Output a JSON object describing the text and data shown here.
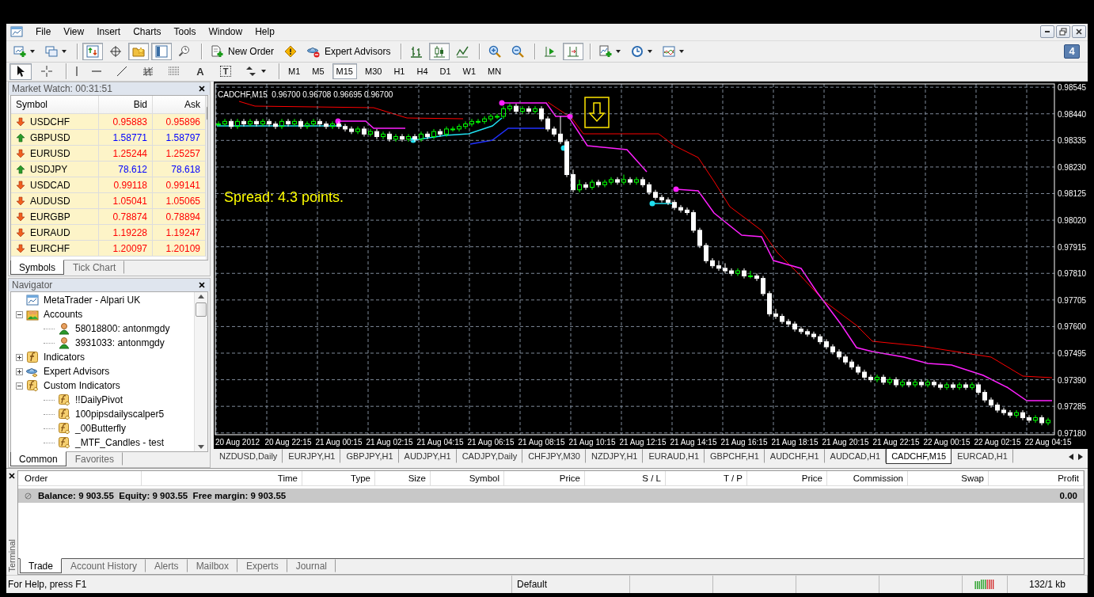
{
  "menu": {
    "items": [
      "File",
      "View",
      "Insert",
      "Charts",
      "Tools",
      "Window",
      "Help"
    ]
  },
  "toolbar": [
    [
      {
        "kind": "new-chart",
        "dropdown": true,
        "selected": false
      },
      {
        "kind": "profiles",
        "dropdown": true,
        "selected": false
      }
    ],
    [
      {
        "kind": "market-watch",
        "selected": true
      },
      {
        "kind": "data-window",
        "selected": false
      },
      {
        "kind": "favorites",
        "selected": true
      },
      {
        "kind": "navigator",
        "selected": true
      },
      {
        "kind": "tester",
        "selected": false
      }
    ],
    [
      {
        "kind": "new-order",
        "label": "New Order",
        "selected": false
      },
      {
        "kind": "alert",
        "selected": false
      },
      {
        "kind": "experts",
        "label": "Expert Advisors",
        "selected": false
      }
    ],
    [
      {
        "kind": "bar-chart",
        "selected": false
      },
      {
        "kind": "candle-chart",
        "selected": true
      },
      {
        "kind": "line-chart",
        "selected": false
      }
    ],
    [
      {
        "kind": "zoom-in",
        "selected": false
      },
      {
        "kind": "zoom-out",
        "selected": false
      }
    ],
    [
      {
        "kind": "autoscroll",
        "selected": false
      },
      {
        "kind": "chart-shift",
        "selected": true
      }
    ],
    [
      {
        "kind": "indicators",
        "dropdown": true,
        "selected": false
      },
      {
        "kind": "periods",
        "dropdown": true,
        "selected": false
      },
      {
        "kind": "templates",
        "dropdown": true,
        "selected": false
      }
    ]
  ],
  "badge": "4",
  "tools": [
    [
      {
        "kind": "cursor",
        "selected": true
      },
      {
        "kind": "crosshair",
        "selected": false
      }
    ],
    [
      {
        "kind": "vline",
        "selected": false
      },
      {
        "kind": "hline",
        "selected": false
      },
      {
        "kind": "trendline",
        "selected": false
      },
      {
        "kind": "fibo",
        "selected": false
      },
      {
        "kind": "fibo-channel",
        "selected": false
      },
      {
        "kind": "text",
        "glyph": "A",
        "selected": false
      },
      {
        "kind": "label",
        "glyph": "T",
        "selected": false
      },
      {
        "kind": "arrows",
        "dropdown": true,
        "selected": false
      }
    ]
  ],
  "timeframes": [
    {
      "label": "M1",
      "selected": false
    },
    {
      "label": "M5",
      "selected": false
    },
    {
      "label": "M15",
      "selected": true
    },
    {
      "label": "M30",
      "selected": false
    },
    {
      "label": "H1",
      "selected": false
    },
    {
      "label": "H4",
      "selected": false
    },
    {
      "label": "D1",
      "selected": false
    },
    {
      "label": "W1",
      "selected": false
    },
    {
      "label": "MN",
      "selected": false
    }
  ],
  "market_watch": {
    "title": "Market Watch: 00:31:51",
    "columns": [
      "Symbol",
      "Bid",
      "Ask"
    ],
    "rows": [
      {
        "symbol": "USDCHF",
        "bid": "0.95883",
        "ask": "0.95896",
        "kind": "down"
      },
      {
        "symbol": "GBPUSD",
        "bid": "1.58771",
        "ask": "1.58797",
        "kind": "up"
      },
      {
        "symbol": "EURUSD",
        "bid": "1.25244",
        "ask": "1.25257",
        "kind": "down"
      },
      {
        "symbol": "USDJPY",
        "bid": "78.612",
        "ask": "78.618",
        "kind": "up"
      },
      {
        "symbol": "USDCAD",
        "bid": "0.99118",
        "ask": "0.99141",
        "kind": "down"
      },
      {
        "symbol": "AUDUSD",
        "bid": "1.05041",
        "ask": "1.05065",
        "kind": "down"
      },
      {
        "symbol": "EURGBP",
        "bid": "0.78874",
        "ask": "0.78894",
        "kind": "down"
      },
      {
        "symbol": "EURAUD",
        "bid": "1.19228",
        "ask": "1.19247",
        "kind": "down"
      },
      {
        "symbol": "EURCHF",
        "bid": "1.20097",
        "ask": "1.20109",
        "kind": "down"
      }
    ],
    "tabs": [
      {
        "label": "Symbols",
        "selected": true
      },
      {
        "label": "Tick Chart",
        "selected": false
      }
    ]
  },
  "navigator": {
    "title": "Navigator",
    "tree": [
      {
        "label": "MetaTrader - Alpari UK",
        "kind": "terminal"
      },
      {
        "label": "Accounts",
        "kind": "accounts",
        "expanded": true,
        "children": [
          {
            "label": "58018800: antonmgdy",
            "kind": "account"
          },
          {
            "label": "3931033: antonmgdy",
            "kind": "account"
          }
        ]
      },
      {
        "label": "Indicators",
        "kind": "indicators",
        "expanded": false
      },
      {
        "label": "Expert Advisors",
        "kind": "experts",
        "expanded": false
      },
      {
        "label": "Custom Indicators",
        "kind": "custom",
        "expanded": true,
        "children": [
          {
            "label": "!!DailyPivot",
            "kind": "custom"
          },
          {
            "label": "100pipsdailyscalper5",
            "kind": "custom"
          },
          {
            "label": "_00Butterfly",
            "kind": "custom"
          },
          {
            "label": "_MTF_Candles - test",
            "kind": "custom"
          }
        ]
      }
    ],
    "tabs": [
      {
        "label": "Common",
        "selected": true
      },
      {
        "label": "Favorites",
        "selected": false
      }
    ]
  },
  "chart": {
    "title": "CADCHF,M15",
    "ohlc": "0.96700 0.96708 0.96695 0.96700",
    "spread": "Spread: 4.3 points.",
    "chart_data": {
      "type": "candlestick",
      "categories": [
        null,
        null,
        null,
        "20 Aug 2012",
        null,
        null,
        null,
        null,
        null,
        null,
        null,
        "20 Aug 22:15",
        null,
        null,
        null,
        null,
        null,
        null,
        null,
        "21 Aug 00:15",
        null,
        null,
        null,
        null,
        null,
        null,
        null,
        "21 Aug 02:15",
        null,
        null,
        null,
        null,
        null,
        null,
        null,
        "21 Aug 04:15",
        null,
        null,
        null,
        null,
        null,
        null,
        null,
        "21 Aug 06:15",
        null,
        null,
        null,
        null,
        null,
        null,
        null,
        "21 Aug 08:15",
        null,
        null,
        null,
        null,
        null,
        null,
        null,
        "21 Aug 10:15",
        null,
        null,
        null,
        null,
        null,
        null,
        null,
        "21 Aug 12:15",
        null,
        null,
        null,
        null,
        null,
        null,
        null,
        "21 Aug 14:15",
        null,
        null,
        null,
        null,
        null,
        null,
        null,
        "21 Aug 16:15",
        null,
        null,
        null,
        null,
        null,
        null,
        null,
        "21 Aug 18:15",
        null,
        null,
        null,
        null,
        null,
        null,
        null,
        "21 Aug 20:15",
        null,
        null,
        null,
        null,
        null,
        null,
        null,
        "21 Aug 22:15",
        null,
        null,
        null,
        null,
        null,
        null,
        null,
        "22 Aug 00:15",
        null,
        null,
        null,
        null,
        null,
        null,
        null,
        "22 Aug 02:15",
        null,
        null,
        null,
        null,
        null,
        null,
        null,
        "22 Aug 04:15"
      ],
      "ylim": [
        0.97173,
        0.98558
      ],
      "grid": true,
      "ohlc": [
        [
          0.984,
          0.9841,
          0.9839,
          0.984
        ],
        [
          0.984,
          0.9842,
          0.9839,
          0.9841
        ],
        [
          0.9841,
          0.9842,
          0.9838,
          0.9839
        ],
        [
          0.9839,
          0.9842,
          0.9838,
          0.9841
        ],
        [
          0.9841,
          0.9842,
          0.9839,
          0.984
        ],
        [
          0.984,
          0.9842,
          0.9839,
          0.9841
        ],
        [
          0.9841,
          0.9842,
          0.9839,
          0.984
        ],
        [
          0.984,
          0.9842,
          0.9839,
          0.9841
        ],
        [
          0.9841,
          0.9842,
          0.9839,
          0.984
        ],
        [
          0.984,
          0.9841,
          0.9838,
          0.9839
        ],
        [
          0.9839,
          0.9842,
          0.9838,
          0.9841
        ],
        [
          0.9841,
          0.9842,
          0.9839,
          0.984
        ],
        [
          0.984,
          0.9842,
          0.9839,
          0.9841
        ],
        [
          0.9841,
          0.9842,
          0.9838,
          0.9839
        ],
        [
          0.9839,
          0.9841,
          0.9838,
          0.984
        ],
        [
          0.984,
          0.9842,
          0.9839,
          0.9841
        ],
        [
          0.9841,
          0.9842,
          0.9839,
          0.984
        ],
        [
          0.984,
          0.9841,
          0.9838,
          0.9839
        ],
        [
          0.9839,
          0.9841,
          0.9838,
          0.984
        ],
        [
          0.984,
          0.9841,
          0.9838,
          0.9839
        ],
        [
          0.9839,
          0.984,
          0.9837,
          0.9838
        ],
        [
          0.9838,
          0.9839,
          0.9836,
          0.9837
        ],
        [
          0.9837,
          0.9839,
          0.9836,
          0.9838
        ],
        [
          0.9838,
          0.9839,
          0.9835,
          0.9836
        ],
        [
          0.9836,
          0.9838,
          0.9835,
          0.9837
        ],
        [
          0.9837,
          0.9838,
          0.9834,
          0.9835
        ],
        [
          0.9835,
          0.9837,
          0.9834,
          0.9836
        ],
        [
          0.9836,
          0.9837,
          0.9833,
          0.9834
        ],
        [
          0.9834,
          0.9836,
          0.9833,
          0.9835
        ],
        [
          0.9835,
          0.9836,
          0.9833,
          0.9834
        ],
        [
          0.9834,
          0.9836,
          0.9833,
          0.9835
        ],
        [
          0.9835,
          0.9836,
          0.9833,
          0.9834
        ],
        [
          0.9834,
          0.9837,
          0.9833,
          0.9836
        ],
        [
          0.9836,
          0.9837,
          0.9834,
          0.9835
        ],
        [
          0.9835,
          0.9838,
          0.9834,
          0.9837
        ],
        [
          0.9837,
          0.9838,
          0.9835,
          0.9836
        ],
        [
          0.9836,
          0.9839,
          0.9835,
          0.9838
        ],
        [
          0.9838,
          0.9839,
          0.9837,
          0.9838
        ],
        [
          0.9838,
          0.984,
          0.9837,
          0.9839
        ],
        [
          0.9839,
          0.9841,
          0.9838,
          0.984
        ],
        [
          0.984,
          0.9842,
          0.9839,
          0.9841
        ],
        [
          0.9841,
          0.9842,
          0.984,
          0.9841
        ],
        [
          0.9841,
          0.9843,
          0.984,
          0.9842
        ],
        [
          0.9842,
          0.9844,
          0.9841,
          0.9843
        ],
        [
          0.9843,
          0.9844,
          0.9842,
          0.9843
        ],
        [
          0.9843,
          0.9847,
          0.9842,
          0.9846
        ],
        [
          0.9846,
          0.9848,
          0.9845,
          0.9847
        ],
        [
          0.9847,
          0.9848,
          0.9844,
          0.9845
        ],
        [
          0.9845,
          0.9847,
          0.9844,
          0.9846
        ],
        [
          0.9846,
          0.9847,
          0.9844,
          0.9845
        ],
        [
          0.9845,
          0.9847,
          0.9844,
          0.9846
        ],
        [
          0.9846,
          0.9847,
          0.9841,
          0.9842
        ],
        [
          0.9842,
          0.9843,
          0.9837,
          0.9838
        ],
        [
          0.9838,
          0.9839,
          0.9835,
          0.9836
        ],
        [
          0.9836,
          0.9843,
          0.9832,
          0.9833
        ],
        [
          0.9833,
          0.9834,
          0.9819,
          0.982
        ],
        [
          0.982,
          0.9822,
          0.9813,
          0.9814
        ],
        [
          0.9814,
          0.9818,
          0.9813,
          0.9816
        ],
        [
          0.9816,
          0.9817,
          0.9814,
          0.9815
        ],
        [
          0.9815,
          0.9818,
          0.9814,
          0.9817
        ],
        [
          0.9817,
          0.9818,
          0.9815,
          0.9816
        ],
        [
          0.9816,
          0.9818,
          0.9815,
          0.9817
        ],
        [
          0.9817,
          0.9819,
          0.9816,
          0.9818
        ],
        [
          0.9818,
          0.9819,
          0.9816,
          0.9817
        ],
        [
          0.9817,
          0.982,
          0.9816,
          0.9818
        ],
        [
          0.9818,
          0.9819,
          0.9816,
          0.9817
        ],
        [
          0.9817,
          0.9819,
          0.9816,
          0.9818
        ],
        [
          0.9818,
          0.9819,
          0.9815,
          0.9816
        ],
        [
          0.9816,
          0.9817,
          0.9812,
          0.9813
        ],
        [
          0.9813,
          0.9814,
          0.981,
          0.9811
        ],
        [
          0.9811,
          0.9812,
          0.9809,
          0.981
        ],
        [
          0.981,
          0.9811,
          0.9808,
          0.9809
        ],
        [
          0.9809,
          0.981,
          0.9806,
          0.9807
        ],
        [
          0.9807,
          0.9808,
          0.9805,
          0.9806
        ],
        [
          0.9806,
          0.9807,
          0.9804,
          0.9805
        ],
        [
          0.9805,
          0.9806,
          0.9797,
          0.9798
        ],
        [
          0.9798,
          0.9799,
          0.9791,
          0.9792
        ],
        [
          0.9792,
          0.9793,
          0.9785,
          0.9786
        ],
        [
          0.9786,
          0.9787,
          0.9783,
          0.9784
        ],
        [
          0.9784,
          0.9786,
          0.9782,
          0.9783
        ],
        [
          0.9783,
          0.9785,
          0.9781,
          0.9782
        ],
        [
          0.9782,
          0.9783,
          0.978,
          0.9781
        ],
        [
          0.9781,
          0.9783,
          0.978,
          0.9782
        ],
        [
          0.9782,
          0.9783,
          0.9779,
          0.978
        ],
        [
          0.978,
          0.9782,
          0.9779,
          0.978
        ],
        [
          0.978,
          0.9781,
          0.9778,
          0.9779
        ],
        [
          0.9779,
          0.978,
          0.9772,
          0.9773
        ],
        [
          0.9773,
          0.9774,
          0.9764,
          0.9765
        ],
        [
          0.9765,
          0.9767,
          0.9763,
          0.9764
        ],
        [
          0.9764,
          0.9765,
          0.9761,
          0.9762
        ],
        [
          0.9762,
          0.9763,
          0.976,
          0.9761
        ],
        [
          0.9761,
          0.9762,
          0.9758,
          0.9759
        ],
        [
          0.9759,
          0.976,
          0.9757,
          0.9758
        ],
        [
          0.9758,
          0.9759,
          0.9756,
          0.9757
        ],
        [
          0.9757,
          0.9758,
          0.9755,
          0.9756
        ],
        [
          0.9756,
          0.9757,
          0.9753,
          0.9754
        ],
        [
          0.9754,
          0.9755,
          0.9751,
          0.9752
        ],
        [
          0.9752,
          0.9753,
          0.9749,
          0.975
        ],
        [
          0.975,
          0.9751,
          0.9747,
          0.9748
        ],
        [
          0.9748,
          0.9749,
          0.9745,
          0.9746
        ],
        [
          0.9746,
          0.9747,
          0.9743,
          0.9744
        ],
        [
          0.9744,
          0.9745,
          0.9741,
          0.9742
        ],
        [
          0.9742,
          0.9743,
          0.9739,
          0.974
        ],
        [
          0.974,
          0.9741,
          0.9738,
          0.9739
        ],
        [
          0.9739,
          0.9741,
          0.9738,
          0.974
        ],
        [
          0.974,
          0.9741,
          0.9737,
          0.9738
        ],
        [
          0.9738,
          0.974,
          0.9737,
          0.9739
        ],
        [
          0.9739,
          0.974,
          0.9736,
          0.9737
        ],
        [
          0.9737,
          0.9739,
          0.9736,
          0.9738
        ],
        [
          0.9738,
          0.9739,
          0.9736,
          0.9737
        ],
        [
          0.9737,
          0.9739,
          0.9736,
          0.9738
        ],
        [
          0.9738,
          0.9739,
          0.9736,
          0.9737
        ],
        [
          0.9737,
          0.9739,
          0.9736,
          0.9738
        ],
        [
          0.9738,
          0.9739,
          0.9736,
          0.9737
        ],
        [
          0.9737,
          0.9738,
          0.9735,
          0.9736
        ],
        [
          0.9736,
          0.9738,
          0.9735,
          0.9737
        ],
        [
          0.9737,
          0.9738,
          0.9735,
          0.9736
        ],
        [
          0.9736,
          0.9738,
          0.9735,
          0.9737
        ],
        [
          0.9737,
          0.9738,
          0.9735,
          0.9736
        ],
        [
          0.9736,
          0.9738,
          0.9735,
          0.9737
        ],
        [
          0.9737,
          0.9738,
          0.9733,
          0.9734
        ],
        [
          0.9734,
          0.9735,
          0.973,
          0.9731
        ],
        [
          0.9731,
          0.9732,
          0.9728,
          0.9729
        ],
        [
          0.9729,
          0.973,
          0.9726,
          0.9727
        ],
        [
          0.9727,
          0.9728,
          0.9725,
          0.9726
        ],
        [
          0.9726,
          0.9727,
          0.9724,
          0.9725
        ],
        [
          0.9725,
          0.9727,
          0.9724,
          0.9726
        ],
        [
          0.9726,
          0.9727,
          0.9723,
          0.9724
        ],
        [
          0.9724,
          0.9725,
          0.9722,
          0.9723
        ],
        [
          0.9723,
          0.9725,
          0.9722,
          0.9724
        ],
        [
          0.9724,
          0.9725,
          0.9721,
          0.9722
        ],
        [
          0.9722,
          0.9724,
          0.9721,
          0.9723
        ]
      ],
      "yticks": [
        {
          "value": 0.98545,
          "label": "0.98545"
        },
        {
          "value": 0.9844,
          "label": "0.98440"
        },
        {
          "value": 0.98335,
          "label": "0.98335"
        },
        {
          "value": 0.9823,
          "label": "0.98230"
        },
        {
          "value": 0.98125,
          "label": "0.98125"
        },
        {
          "value": 0.9802,
          "label": "0.98020"
        },
        {
          "value": 0.97915,
          "label": "0.97915"
        },
        {
          "value": 0.9781,
          "label": "0.97810"
        },
        {
          "value": 0.97705,
          "label": "0.97705"
        },
        {
          "value": 0.976,
          "label": "0.97600"
        },
        {
          "value": 0.97495,
          "label": "0.97495"
        },
        {
          "value": 0.9739,
          "label": "0.97390"
        },
        {
          "value": 0.97285,
          "label": "0.97285"
        },
        {
          "value": 0.9718,
          "label": "0.97180"
        }
      ]
    }
  },
  "chart_tabs": [
    {
      "label": "NZDUSD,Daily",
      "selected": false
    },
    {
      "label": "EURJPY,H1",
      "selected": false
    },
    {
      "label": "GBPJPY,H1",
      "selected": false
    },
    {
      "label": "AUDJPY,H1",
      "selected": false
    },
    {
      "label": "CADJPY,Daily",
      "selected": false
    },
    {
      "label": "CHFJPY,M30",
      "selected": false
    },
    {
      "label": "NZDJPY,H1",
      "selected": false
    },
    {
      "label": "EURAUD,H1",
      "selected": false
    },
    {
      "label": "GBPCHF,H1",
      "selected": false
    },
    {
      "label": "AUDCHF,H1",
      "selected": false
    },
    {
      "label": "AUDCAD,H1",
      "selected": false
    },
    {
      "label": "CADCHF,M15",
      "selected": true
    },
    {
      "label": "EURCAD,H1",
      "selected": false
    }
  ],
  "terminal": {
    "title": "Terminal",
    "columns": [
      "Order",
      "Time",
      "Type",
      "Size",
      "Symbol",
      "Price",
      "S / L",
      "T / P",
      "Price",
      "Commission",
      "Swap",
      "Profit"
    ],
    "summary": "Balance: 9 903.55  Equity: 9 903.55  Free margin: 9 903.55",
    "profit": "0.00",
    "tabs": [
      {
        "label": "Trade",
        "selected": true
      },
      {
        "label": "Account History",
        "selected": false
      },
      {
        "label": "Alerts",
        "selected": false
      },
      {
        "label": "Mailbox",
        "selected": false
      },
      {
        "label": "Experts",
        "selected": false
      },
      {
        "label": "Journal",
        "selected": false
      }
    ]
  },
  "status_bar": {
    "help": "For Help, press F1",
    "profile": "Default",
    "traffic": "132/1 kb"
  }
}
